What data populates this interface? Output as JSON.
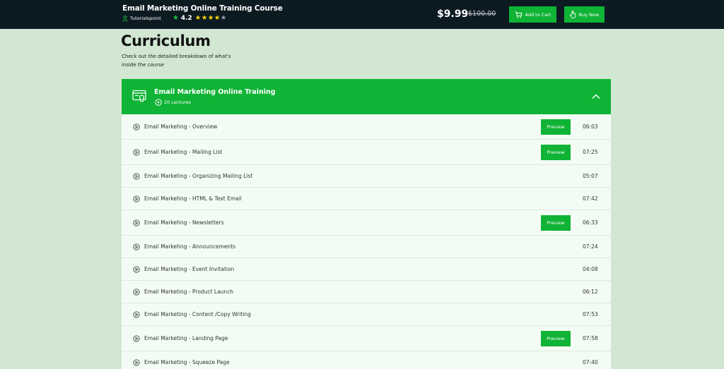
{
  "header": {
    "course_title": "Email Marketing Online Training Course",
    "author": "Tutorialspoint",
    "rating": "4.2",
    "stars_filled": 4,
    "stars_total": 5,
    "price": "$9.99",
    "old_price": "$100.00",
    "add_to_cart_label": "Add to Cart",
    "buy_now_label": "Buy Now"
  },
  "curriculum": {
    "title": "Curriculum",
    "subtitle": "Check out the detailed breakdown of what's inside the course"
  },
  "section": {
    "title": "Email Marketing Online Training",
    "lectures_count": "20 Lectures",
    "expanded": true
  },
  "preview_label": "Preview",
  "lectures": [
    {
      "name": "Email Marketing - Overview",
      "duration": "06:03",
      "preview": true
    },
    {
      "name": "Email Marketing - Mailing List",
      "duration": "07:25",
      "preview": true
    },
    {
      "name": "Email Marketing - Organizing Mailing List",
      "duration": "05:07",
      "preview": false
    },
    {
      "name": "Email Marketing - HTML & Text Email",
      "duration": "07:42",
      "preview": false
    },
    {
      "name": "Email Marketing - Newsletters",
      "duration": "06:33",
      "preview": true
    },
    {
      "name": "Email Marketing - Announcements",
      "duration": "07:24",
      "preview": false
    },
    {
      "name": "Email Marketing - Event Invitation",
      "duration": "04:08",
      "preview": false
    },
    {
      "name": "Email Marketing - Product Launch",
      "duration": "06:12",
      "preview": false
    },
    {
      "name": "Email Marketing - Content /Copy Writing",
      "duration": "07:53",
      "preview": false
    },
    {
      "name": "Email Marketing - Landing Page",
      "duration": "07:58",
      "preview": true
    },
    {
      "name": "Email Marketing - Squeeze Page",
      "duration": "07:40",
      "preview": false
    }
  ],
  "colors": {
    "topbar": "#0c1a22",
    "accent_green": "#0fb335",
    "page_bg": "#d1e7d2",
    "list_bg": "#f3fcf4",
    "star_yellow": "#ffd800"
  },
  "icons": {
    "author": "user-icon",
    "rating": "star-icon",
    "cart": "cart-icon",
    "buy": "hand-pointer-icon",
    "section": "course-certificate-icon",
    "lectures": "play-circle-icon",
    "collapse": "chevron-up-icon",
    "lecture": "play-circle-icon"
  }
}
